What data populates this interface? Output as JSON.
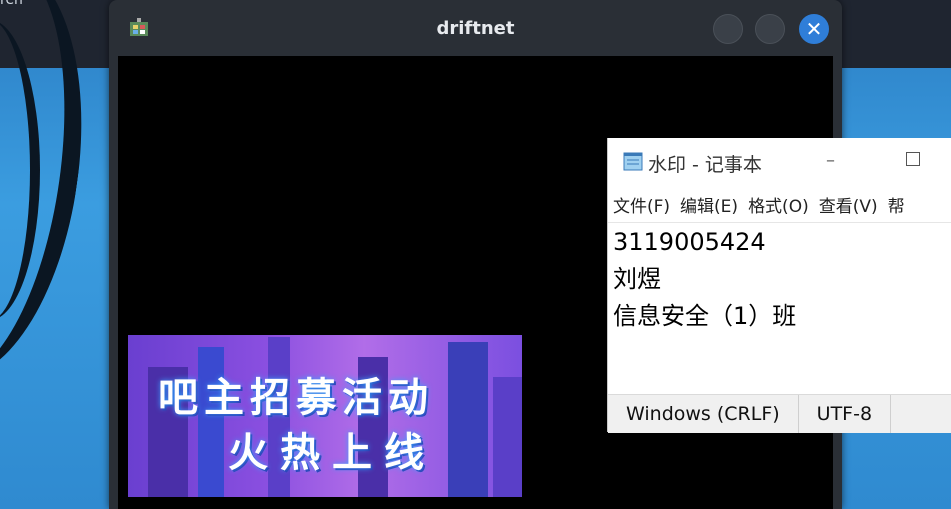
{
  "desktop": {
    "corner_text": "ren"
  },
  "driftnet": {
    "title": "driftnet",
    "app_icon": "driftnet-app-icon",
    "buttons": {
      "minimize": "minimize-button",
      "maximize": "maximize-button",
      "close": "✕"
    },
    "banner": {
      "line1": "吧主招募活动",
      "line2": "火热上线"
    }
  },
  "notepad": {
    "title": "水印 - 记事本",
    "minimize_glyph": "–",
    "menu": [
      "文件(F)",
      "编辑(E)",
      "格式(O)",
      "查看(V)",
      "帮"
    ],
    "content": [
      "3119005424",
      "刘煜",
      "信息安全（1）班"
    ],
    "status": {
      "line_ending": "Windows (CRLF)",
      "encoding": "UTF-8"
    }
  }
}
